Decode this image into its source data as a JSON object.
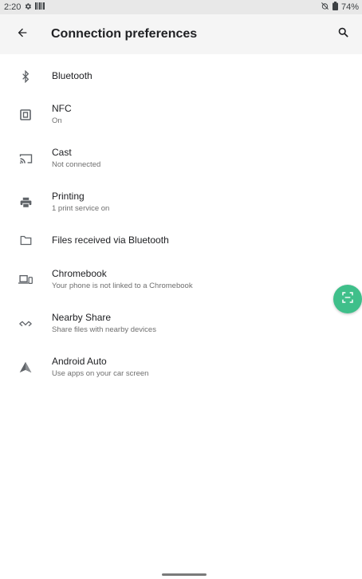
{
  "status_bar": {
    "time": "2:20",
    "battery": "74%"
  },
  "app_bar": {
    "title": "Connection preferences"
  },
  "items": [
    {
      "label": "Bluetooth",
      "subtitle": ""
    },
    {
      "label": "NFC",
      "subtitle": "On"
    },
    {
      "label": "Cast",
      "subtitle": "Not connected"
    },
    {
      "label": "Printing",
      "subtitle": "1 print service on"
    },
    {
      "label": "Files received via Bluetooth",
      "subtitle": ""
    },
    {
      "label": "Chromebook",
      "subtitle": "Your phone is not linked to a Chromebook"
    },
    {
      "label": "Nearby Share",
      "subtitle": "Share files with nearby devices"
    },
    {
      "label": "Android Auto",
      "subtitle": "Use apps on your car screen"
    }
  ],
  "colors": {
    "fab": "#3fbf8a",
    "icon": "#5f6368"
  }
}
